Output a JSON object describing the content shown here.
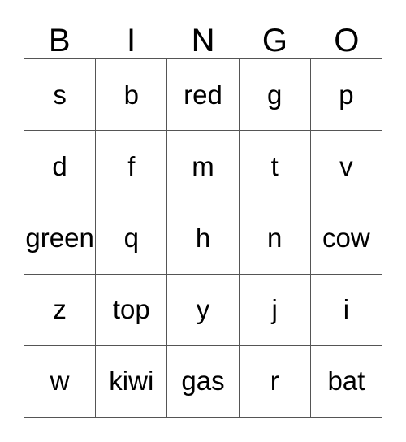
{
  "card": {
    "title": "BINGO",
    "columns": [
      "B",
      "I",
      "N",
      "G",
      "O"
    ],
    "border_color": "#555555",
    "text_color": "#000000",
    "background_color": "#ffffff",
    "rows": [
      {
        "cells": [
          "s",
          "b",
          "red",
          "g",
          "p"
        ]
      },
      {
        "cells": [
          "d",
          "f",
          "m",
          "t",
          "v"
        ]
      },
      {
        "cells": [
          "green",
          "q",
          "h",
          "n",
          "cow"
        ]
      },
      {
        "cells": [
          "z",
          "top",
          "y",
          "j",
          "i"
        ]
      },
      {
        "cells": [
          "w",
          "kiwi",
          "gas",
          "r",
          "bat"
        ]
      }
    ]
  }
}
